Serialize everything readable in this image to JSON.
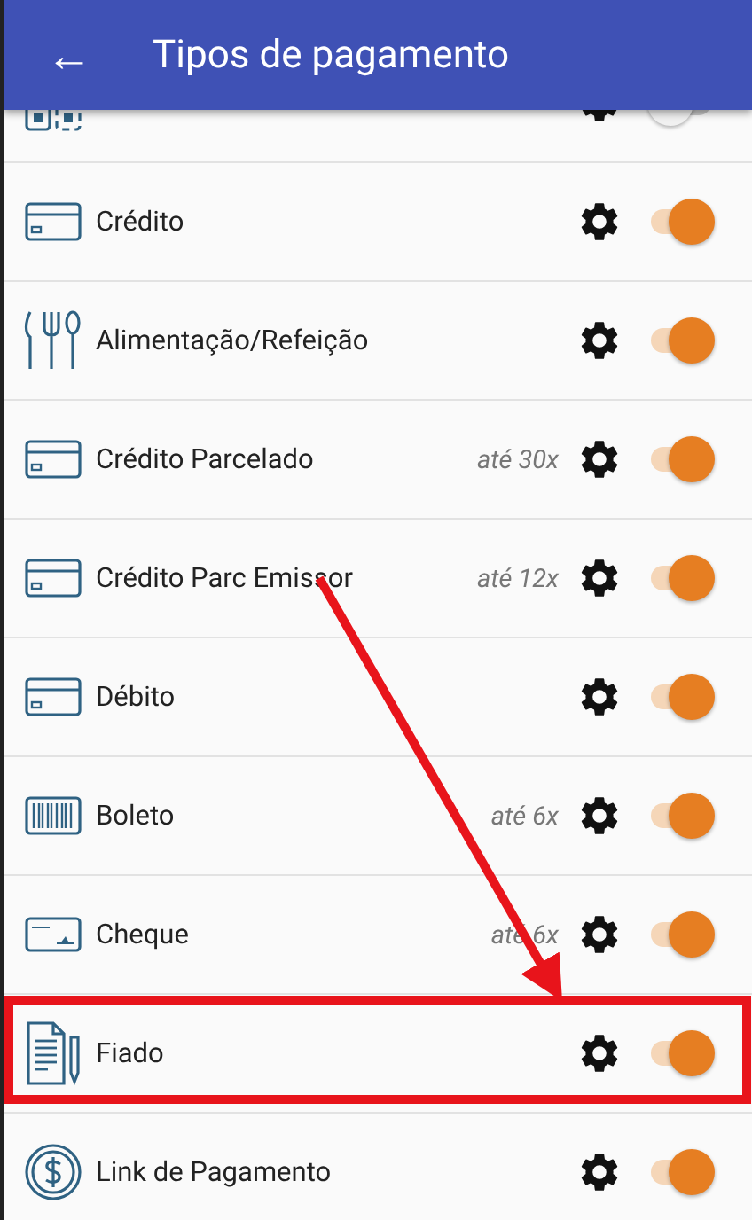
{
  "app_bar": {
    "back": "←",
    "title": "Tipos de pagamento"
  },
  "clipped_row": {
    "kind": "qr",
    "on": false
  },
  "payment_types": [
    {
      "kind": "card",
      "label": "Crédito",
      "on": true
    },
    {
      "kind": "cutlery",
      "label": "Alimentação/Refeição",
      "on": true
    },
    {
      "kind": "card",
      "label": "Crédito Parcelado",
      "installments": "até 30x",
      "on": true
    },
    {
      "kind": "card",
      "label": "Crédito Parc Emissor",
      "installments": "até 12x",
      "on": true
    },
    {
      "kind": "card",
      "label": "Débito",
      "on": true
    },
    {
      "kind": "barcode",
      "label": "Boleto",
      "installments": "até 6x",
      "on": true
    },
    {
      "kind": "check",
      "label": "Cheque",
      "installments": "até 6x",
      "on": true
    },
    {
      "kind": "document",
      "label": "Fiado",
      "on": true,
      "highlighted": true
    },
    {
      "kind": "dollar",
      "label": "Link de Pagamento",
      "on": true
    }
  ]
}
